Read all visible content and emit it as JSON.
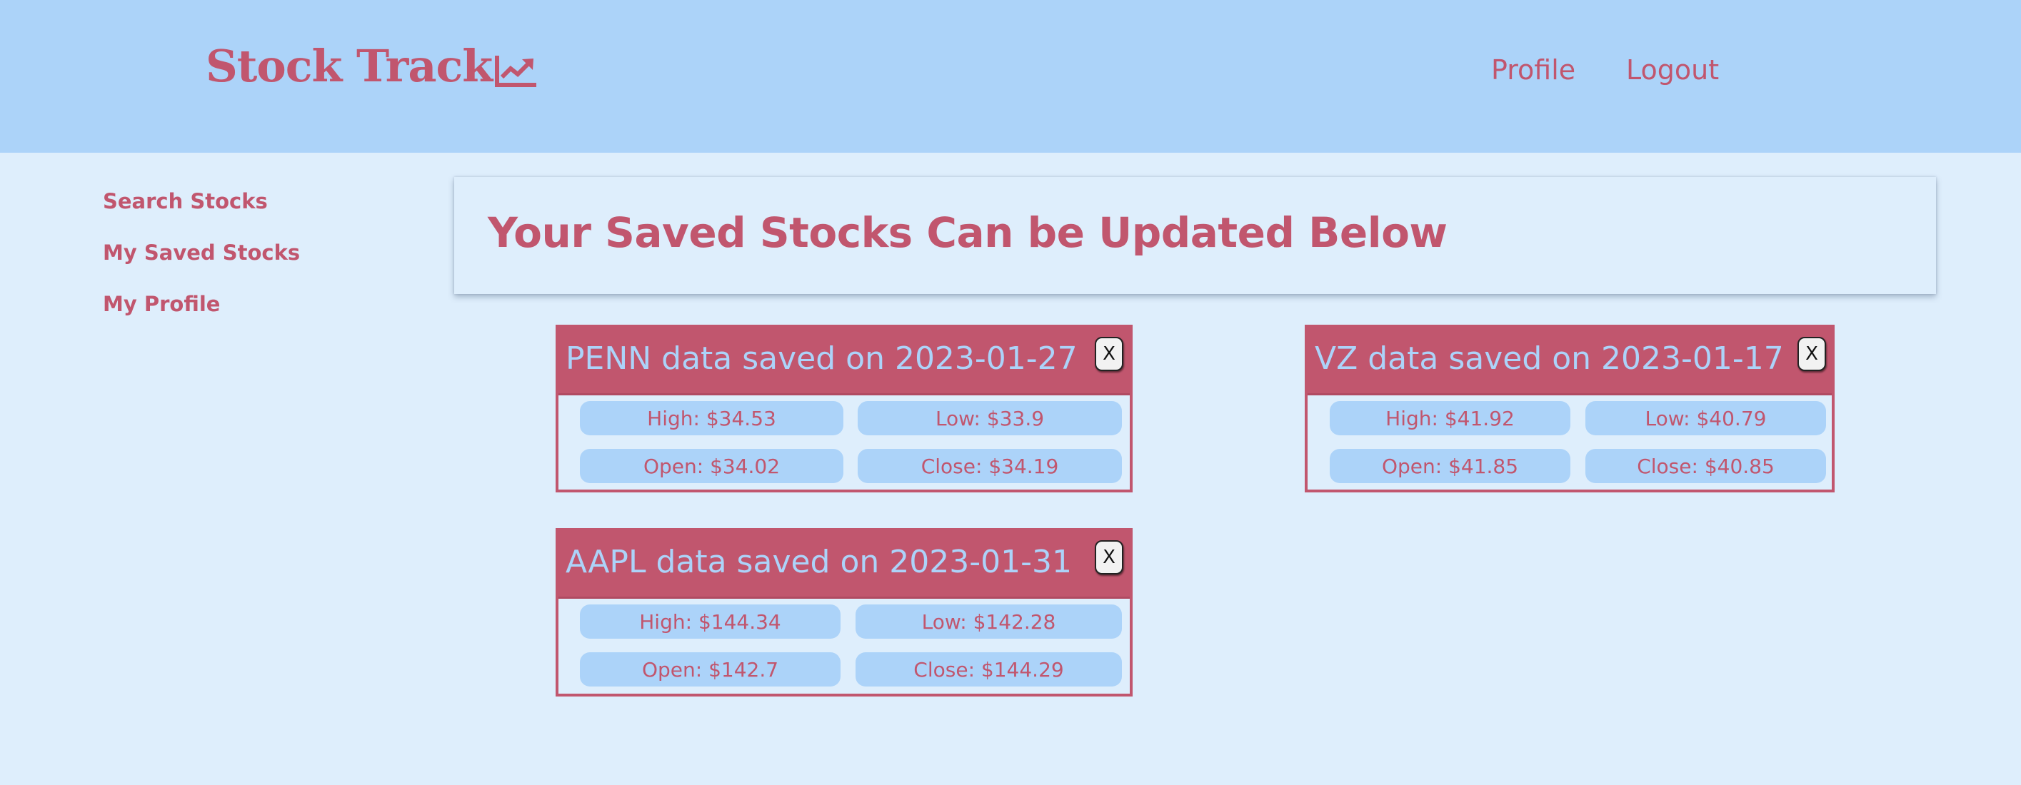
{
  "header": {
    "brand": "Stock Track",
    "brand_icon": "trending-up-icon",
    "nav": {
      "profile": "Profile",
      "logout": "Logout"
    }
  },
  "sidebar": {
    "items": [
      {
        "label": "Search Stocks"
      },
      {
        "label": "My Saved Stocks"
      },
      {
        "label": "My Profile"
      }
    ]
  },
  "main": {
    "title": "Your Saved Stocks Can be Updated Below",
    "close_label": "X",
    "cards": [
      {
        "title": "PENN data saved on 2023-01-27",
        "high": "High: $34.53",
        "low": "Low: $33.9",
        "open": "Open: $34.02",
        "close": "Close: $34.19"
      },
      {
        "title": "VZ data saved on 2023-01-17",
        "high": "High: $41.92",
        "low": "Low: $40.79",
        "open": "Open: $41.85",
        "close": "Close: $40.85"
      },
      {
        "title": "AAPL data saved on 2023-01-31",
        "high": "High: $144.34",
        "low": "Low: $142.28",
        "open": "Open: $142.7",
        "close": "Close: $144.29"
      }
    ]
  },
  "colors": {
    "header_bg": "#acd3f9",
    "page_bg": "#deeefc",
    "accent": "#c1566e"
  }
}
